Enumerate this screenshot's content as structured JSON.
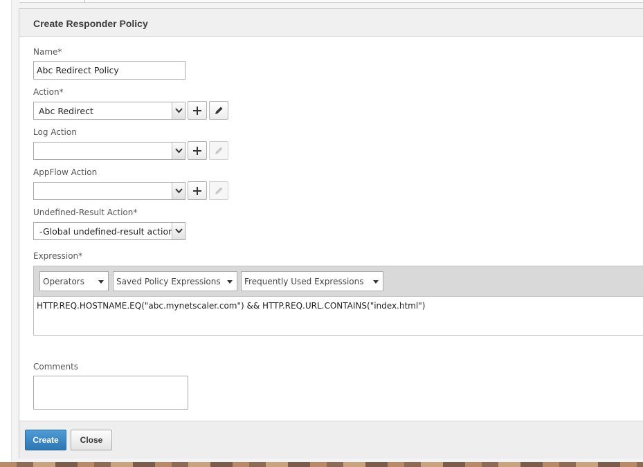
{
  "panel": {
    "title": "Create Responder Policy"
  },
  "fields": {
    "name": {
      "label": "Name*",
      "value": "Abc Redirect Policy"
    },
    "action": {
      "label": "Action*",
      "value": "Abc Redirect"
    },
    "log_action": {
      "label": "Log Action",
      "value": ""
    },
    "appflow_action": {
      "label": "AppFlow Action",
      "value": ""
    },
    "undefined_result_action": {
      "label": "Undefined-Result Action*",
      "value": "-Global undefined-result action-"
    }
  },
  "expression": {
    "label": "Expression*",
    "toolbar": {
      "operators": "Operators",
      "saved": "Saved Policy Expressions",
      "frequent": "Frequently Used Expressions"
    },
    "value": "HTTP.REQ.HOSTNAME.EQ(\"abc.mynetscaler.com\") && HTTP.REQ.URL.CONTAINS(\"index.html\")"
  },
  "comments": {
    "label": "Comments",
    "value": ""
  },
  "buttons": {
    "create": "Create",
    "close": "Close"
  },
  "icons": {
    "dropdown": "chevron-down-icon",
    "add": "plus-icon",
    "edit": "pencil-icon"
  },
  "colors": {
    "primary_button": "#2d77b5",
    "header_bg": "#f0f0f0",
    "toolbar_bg": "#d9d9d9"
  }
}
